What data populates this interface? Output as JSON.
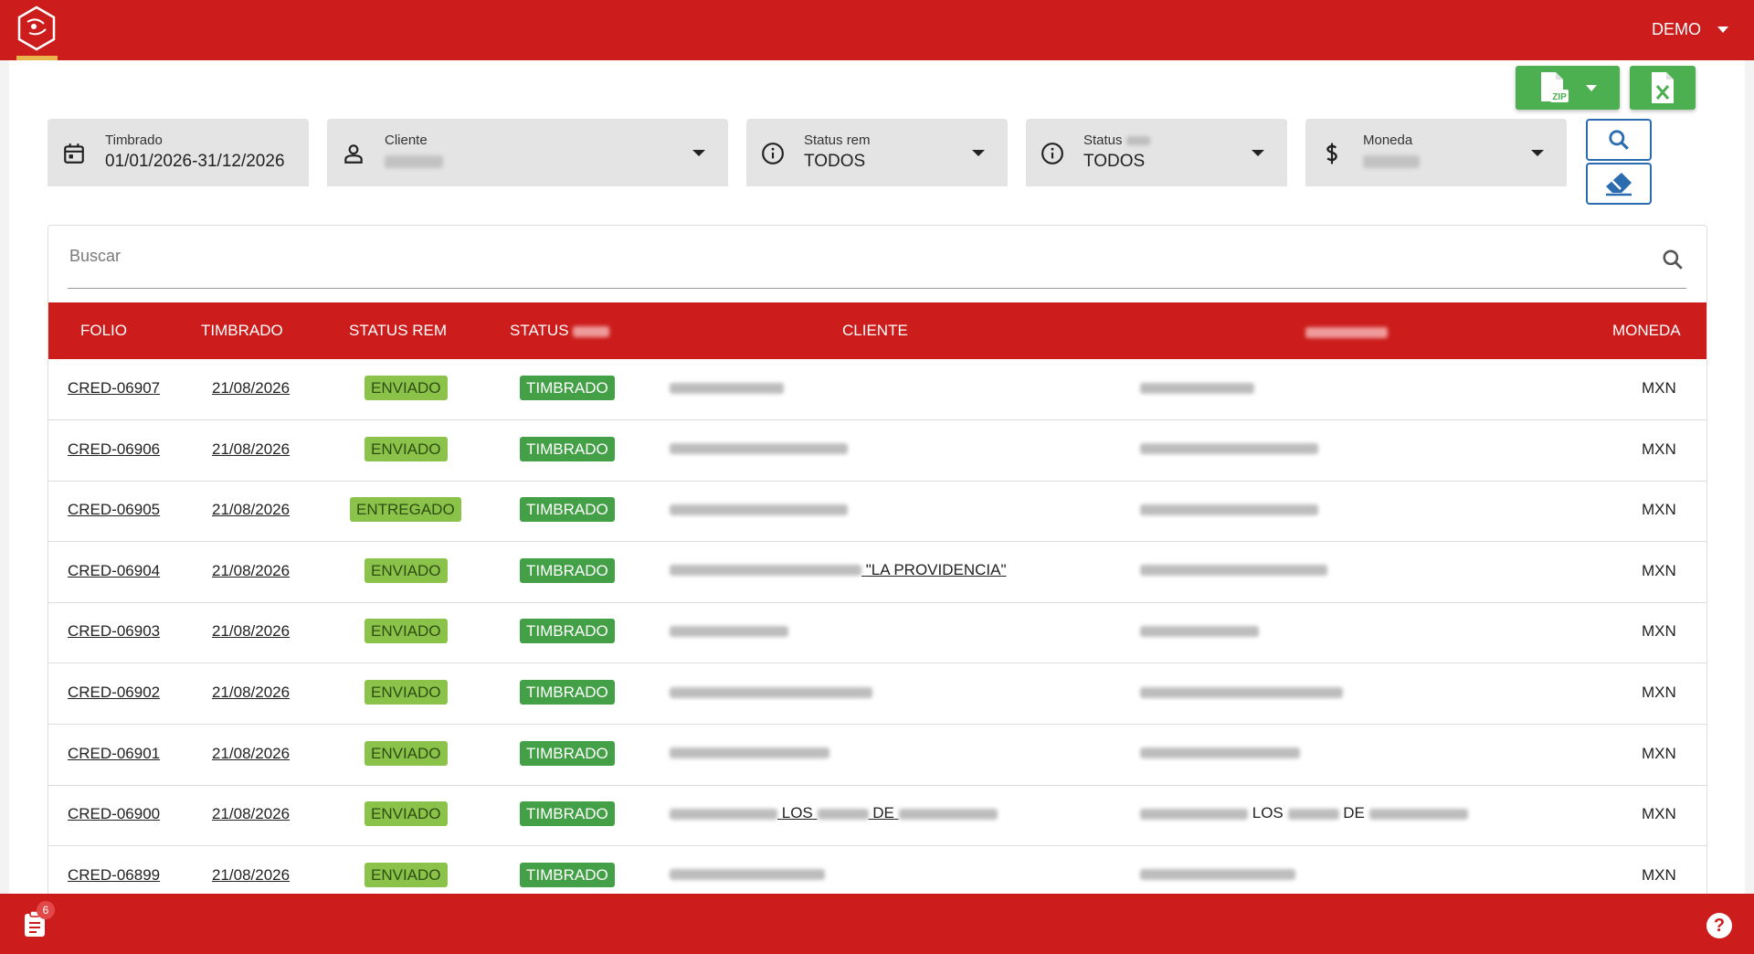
{
  "header": {
    "user": "DEMO"
  },
  "toolbar": {
    "zip_label": "ZIP"
  },
  "filters": {
    "timbrado": {
      "label": "Timbrado",
      "value": "01/01/2026-31/12/2026"
    },
    "cliente": {
      "label": "Cliente"
    },
    "status_rem": {
      "label": "Status rem",
      "value": "TODOS"
    },
    "status": {
      "label": "Status",
      "value": "TODOS"
    },
    "moneda": {
      "label": "Moneda"
    }
  },
  "search": {
    "placeholder": "Buscar"
  },
  "table": {
    "headers": {
      "folio": "FOLIO",
      "timbrado": "TIMBRADO",
      "status_rem": "STATUS REM",
      "status": "STATUS",
      "cliente": "CLIENTE",
      "moneda": "MONEDA"
    },
    "rows": [
      {
        "folio": "CRED-06907",
        "timbrado": "21/08/2026",
        "status_rem": "ENVIADO",
        "status": "TIMBRADO",
        "moneda": "MXN"
      },
      {
        "folio": "CRED-06906",
        "timbrado": "21/08/2026",
        "status_rem": "ENVIADO",
        "status": "TIMBRADO",
        "moneda": "MXN"
      },
      {
        "folio": "CRED-06905",
        "timbrado": "21/08/2026",
        "status_rem": "ENTREGADO",
        "status": "TIMBRADO",
        "moneda": "MXN"
      },
      {
        "folio": "CRED-06904",
        "timbrado": "21/08/2026",
        "status_rem": "ENVIADO",
        "status": "TIMBRADO",
        "cliente_suffix": "\"LA PROVIDENCIA\"",
        "moneda": "MXN"
      },
      {
        "folio": "CRED-06903",
        "timbrado": "21/08/2026",
        "status_rem": "ENVIADO",
        "status": "TIMBRADO",
        "moneda": "MXN"
      },
      {
        "folio": "CRED-06902",
        "timbrado": "21/08/2026",
        "status_rem": "ENVIADO",
        "status": "TIMBRADO",
        "moneda": "MXN"
      },
      {
        "folio": "CRED-06901",
        "timbrado": "21/08/2026",
        "status_rem": "ENVIADO",
        "status": "TIMBRADO",
        "moneda": "MXN"
      },
      {
        "folio": "CRED-06900",
        "timbrado": "21/08/2026",
        "status_rem": "ENVIADO",
        "status": "TIMBRADO",
        "cliente_words": [
          "LOS",
          "DE"
        ],
        "receptor_words": [
          "LOS",
          "DE"
        ],
        "moneda": "MXN"
      },
      {
        "folio": "CRED-06899",
        "timbrado": "21/08/2026",
        "status_rem": "ENVIADO",
        "status": "TIMBRADO",
        "moneda": "MXN"
      }
    ]
  },
  "footer": {
    "notifications": "6"
  },
  "colors": {
    "brand": "#cc1c1c",
    "green": "#4caf50",
    "accent_blue": "#2b6cb0"
  }
}
